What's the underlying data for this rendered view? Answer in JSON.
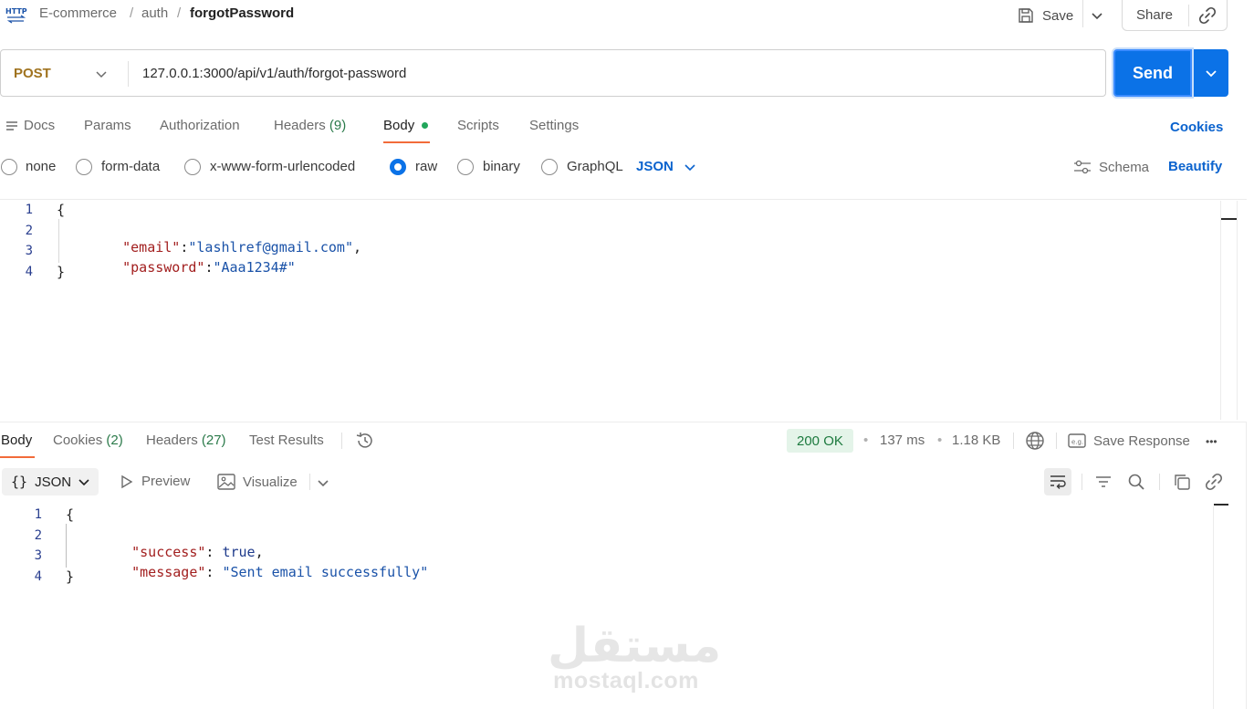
{
  "breadcrumb": {
    "collection": "E-commerce",
    "folder": "auth",
    "request": "forgotPassword",
    "separator": "/"
  },
  "toolbar": {
    "save_label": "Save",
    "share_label": "Share"
  },
  "request": {
    "method": "POST",
    "url": "127.0.0.1:3000/api/v1/auth/forgot-password",
    "send_label": "Send"
  },
  "request_tabs": {
    "docs": "Docs",
    "params": "Params",
    "authorization": "Authorization",
    "headers": "Headers",
    "headers_count": "(9)",
    "body": "Body",
    "scripts": "Scripts",
    "settings": "Settings",
    "cookies": "Cookies"
  },
  "body_types": {
    "none": "none",
    "form_data": "form-data",
    "urlencoded": "x-www-form-urlencoded",
    "raw": "raw",
    "binary": "binary",
    "graphql": "GraphQL",
    "format": "JSON",
    "selected": "raw",
    "schema": "Schema",
    "beautify": "Beautify"
  },
  "request_body": {
    "line_numbers": [
      "1",
      "2",
      "3",
      "4"
    ],
    "open_brace": "{",
    "close_brace": "}",
    "email_key": "\"email\"",
    "email_value": "\"lashlref@gmail.com\"",
    "password_key": "\"password\"",
    "password_value": "\"Aaa1234#\"",
    "colon": ":",
    "comma": ","
  },
  "response_tabs": {
    "body": "Body",
    "cookies": "Cookies",
    "cookies_count": "(2)",
    "headers": "Headers",
    "headers_count": "(27)",
    "test_results": "Test Results"
  },
  "response_meta": {
    "status": "200 OK",
    "time": "137 ms",
    "size": "1.18 KB",
    "separator": "•",
    "save_response": "Save Response",
    "more": "•••"
  },
  "response_view": {
    "format": "JSON",
    "preview": "Preview",
    "visualize": "Visualize"
  },
  "response_body": {
    "line_numbers": [
      "1",
      "2",
      "3",
      "4"
    ],
    "open_brace": "{",
    "close_brace": "}",
    "success_key": "\"success\"",
    "success_value": "true",
    "message_key": "\"message\"",
    "message_value": "\"Sent email successfully\"",
    "colon_space": ": ",
    "comma": ","
  },
  "watermark": {
    "arabic": "مستقل",
    "latin": "mostaql.com"
  },
  "colors": {
    "accent": "#0b72e7",
    "tab_underline": "#f26b3a",
    "method": "#a0731f",
    "status_ok": "#1d7a3f"
  }
}
